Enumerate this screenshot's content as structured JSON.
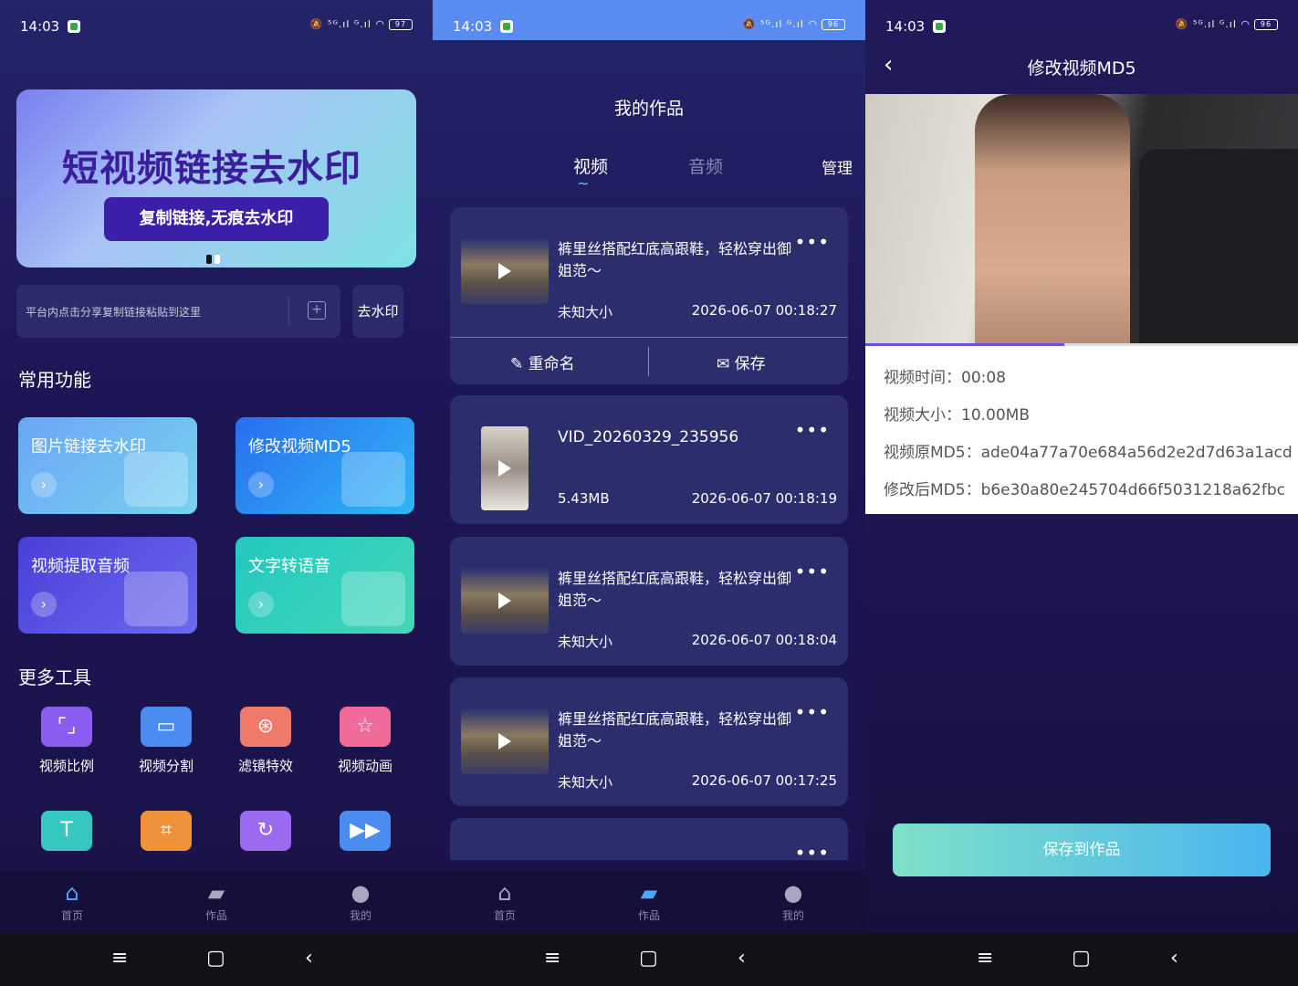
{
  "status": {
    "time": "14:03",
    "signal": "⁵ᴳ.ıl ᴳ.ıl",
    "battery1": "97",
    "battery2": "96",
    "battery3": "96"
  },
  "home": {
    "banner": {
      "title": "短视频链接去水印",
      "button": "复制链接,无痕去水印"
    },
    "input": {
      "placeholder": "平台内点击分享复制链接粘贴到这里",
      "button": "去水印"
    },
    "common_title": "常用功能",
    "cards": [
      {
        "label": "图片链接去水印"
      },
      {
        "label": "修改视频MD5"
      },
      {
        "label": "视频提取音频"
      },
      {
        "label": "文字转语音"
      }
    ],
    "more_title": "更多工具",
    "tools": [
      {
        "label": "视频比例",
        "color": "#8a5cf0"
      },
      {
        "label": "视频分割",
        "color": "#4a8cf0"
      },
      {
        "label": "滤镜特效",
        "color": "#f07a6a"
      },
      {
        "label": "视频动画",
        "color": "#f06a9a"
      }
    ],
    "tools2": [
      {
        "color": "#36c7c0"
      },
      {
        "color": "#f0923a"
      },
      {
        "color": "#9a6af0"
      },
      {
        "color": "#4a8cf0"
      }
    ]
  },
  "tabbar": {
    "home": "首页",
    "works": "作品",
    "mine": "我的"
  },
  "works": {
    "title": "我的作品",
    "tabs": {
      "video": "视频",
      "audio": "音频"
    },
    "manage": "管理",
    "actions": {
      "rename": "重命名",
      "save": "保存"
    },
    "items": [
      {
        "title": "裤里丝搭配红底高跟鞋，轻松穿出御姐范～",
        "size": "未知大小",
        "date": "2026-06-07 00:18:27"
      },
      {
        "title": "VID_20260329_235956",
        "size": "5.43MB",
        "date": "2026-06-07 00:18:19"
      },
      {
        "title": "裤里丝搭配红底高跟鞋，轻松穿出御姐范～",
        "size": "未知大小",
        "date": "2026-06-07 00:18:04"
      },
      {
        "title": "裤里丝搭配红底高跟鞋，轻松穿出御姐范～",
        "size": "未知大小",
        "date": "2026-06-07 00:17:25"
      }
    ]
  },
  "md5": {
    "title": "修改视频MD5",
    "progress": 0.46,
    "time": "视频时间：00:08",
    "size": "视频大小：10.00MB",
    "orig": "视频原MD5：ade04a77a70e684a56d2e2d7d63a1acd",
    "new": "修改后MD5：b6e30a80e245704d66f5031218a62fbc",
    "save_button": "保存到作品"
  }
}
